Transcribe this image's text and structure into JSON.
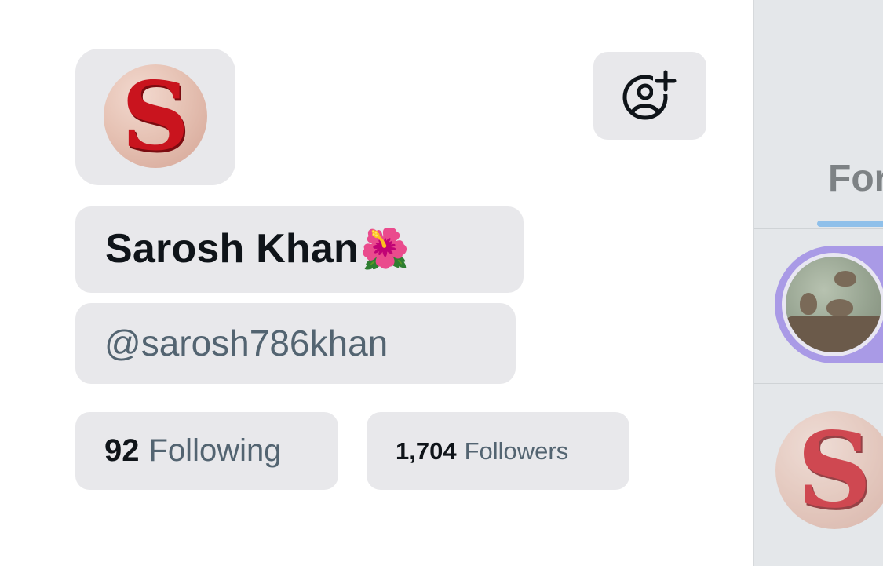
{
  "profile": {
    "name": "Sarosh Khan",
    "name_emoji": "🌺",
    "handle": "@sarosh786khan",
    "avatar_letter": "S"
  },
  "stats": {
    "following_count": "92",
    "following_label": "Following",
    "followers_count": "1,704",
    "followers_label": "Followers"
  },
  "side_panel": {
    "tab_label": "For"
  },
  "icons": {
    "follow": "person-add-icon",
    "avatar": "letter-s-avatar"
  },
  "colors": {
    "chip_bg": "#e8e8eb",
    "text_primary": "#0f1419",
    "text_secondary": "#536471",
    "tab_underline": "#8fc0ea",
    "story_ring": "#a99ae6"
  }
}
